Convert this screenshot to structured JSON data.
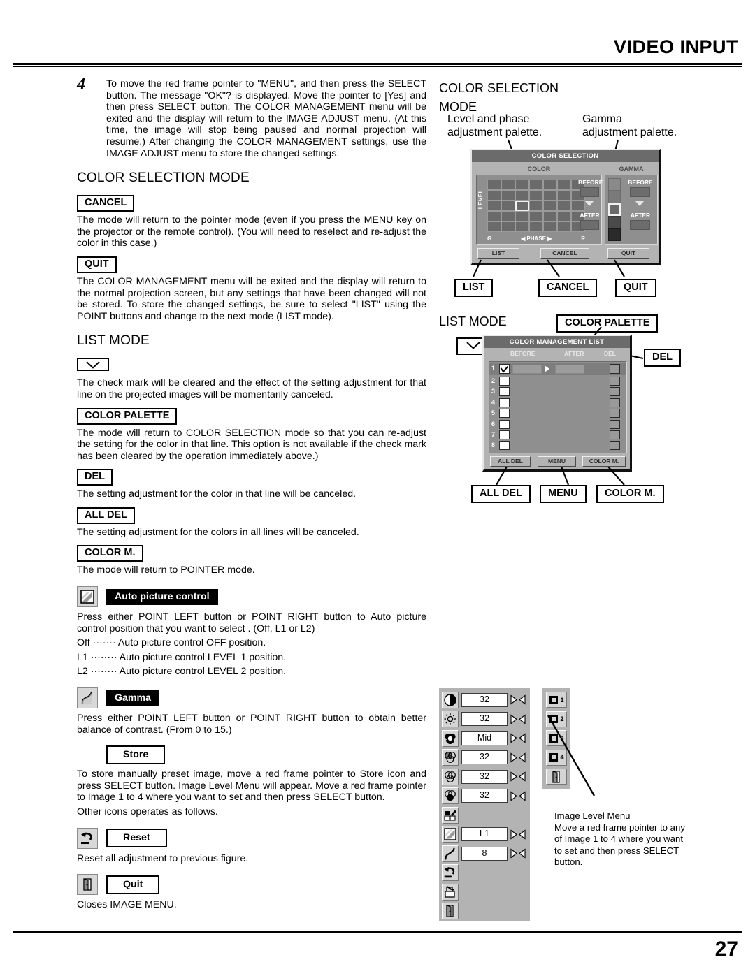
{
  "header": {
    "title": "VIDEO INPUT",
    "page_number": "27"
  },
  "left": {
    "step": {
      "number": "4",
      "text": "To move the red frame pointer to \"MENU\", and then press the SELECT button. The message \"OK\"? is displayed. Move the pointer to [Yes] and then press SELECT button. The COLOR MANAGEMENT menu will be exited and the display will return to the IMAGE ADJUST menu. (At this time, the image will stop being paused and normal projection will resume.) After changing the COLOR MANAGEMENT settings, use the IMAGE ADJUST menu to store the changed settings."
    },
    "color_selection_mode": {
      "heading": "COLOR SELECTION MODE",
      "cancel_key": "CANCEL",
      "cancel_text": "The mode will return to the pointer mode (even if you press the MENU key on the projector or the remote control). (You will need to reselect and re-adjust the color in this case.)",
      "quit_key": "QUIT",
      "quit_text": "The COLOR MANAGEMENT menu will be exited and the display will return to the normal projection screen, but any settings that have been changed will not be stored. To store the changed settings, be sure to select \"LIST\" using the POINT buttons and change to the next mode (LIST mode)."
    },
    "list_mode": {
      "heading": "LIST MODE",
      "check_text": "The check mark will be cleared and the effect of the setting adjustment for that line on the projected images will be momentarily canceled.",
      "color_palette_key": "COLOR PALETTE",
      "color_palette_text": "The mode will return to COLOR SELECTION mode so that you can re-adjust the setting for the color in that line. This option is not available if the check mark has been cleared by the operation immediately above.)",
      "del_key": "DEL",
      "del_text": "The setting adjustment for the color in that line will be canceled.",
      "all_del_key": "ALL DEL",
      "all_del_text": "The setting adjustment for the colors in all lines will be canceled.",
      "color_m_key": "COLOR M.",
      "color_m_text": "The mode will return to POINTER mode."
    },
    "auto_picture_control": {
      "label": "Auto picture control",
      "text": "Press either POINT LEFT button or POINT RIGHT button to Auto picture control position that you want to select . (Off, L1 or L2)",
      "line_off": "Off ······· Auto picture control OFF position.",
      "line_l1": "L1 ········ Auto picture control LEVEL 1 position.",
      "line_l2": "L2 ········ Auto picture control LEVEL 2 position."
    },
    "gamma": {
      "label": "Gamma",
      "text": "Press either POINT LEFT button or POINT RIGHT button to obtain better balance of contrast.  (From 0 to 15.)"
    },
    "store": {
      "label": "Store",
      "text": "To store manually preset image, move a red frame pointer to Store icon and press SELECT button.  Image Level Menu will appear. Move a red frame pointer to Image 1 to 4 where you want to set and then press SELECT button.",
      "other": "Other icons operates as follows."
    },
    "reset": {
      "label": "Reset",
      "text": "Reset all adjustment to previous figure."
    },
    "quit": {
      "label": "Quit",
      "text": "Closes IMAGE MENU."
    }
  },
  "right": {
    "cs_mode_title_l1": "COLOR SELECTION",
    "cs_mode_title_l2": "MODE",
    "callout_level": "Level and phase\nadjustment palette.",
    "callout_level_l1": "Level and phase",
    "callout_level_l2": "adjustment palette.",
    "callout_gamma_l1": "Gamma",
    "callout_gamma_l2": "adjustment palette.",
    "color_selection_panel": {
      "title": "COLOR SELECTION",
      "color_header": "COLOR",
      "gamma_header": "GAMMA",
      "level_axis": "LEVEL",
      "phase_axis_left": "G",
      "phase_axis_label": "◀ PHASE ▶",
      "phase_axis_right": "R",
      "before": "BEFORE",
      "after": "AFTER",
      "gamma_before": "BEFORE",
      "gamma_after": "AFTER",
      "buttons": [
        "LIST",
        "CANCEL",
        "QUIT"
      ]
    },
    "cs_labels": [
      "LIST",
      "CANCEL",
      "QUIT"
    ],
    "list_mode_title": "LIST MODE",
    "color_palette_label": "COLOR PALETTE",
    "del_label": "DEL",
    "cml_panel": {
      "title": "COLOR MANAGEMENT LIST",
      "columns": [
        "BEFORE",
        "AFTER",
        "DEL"
      ],
      "rows": [
        "1",
        "2",
        "3",
        "4",
        "5",
        "6",
        "7",
        "8"
      ],
      "checked_row": "1",
      "buttons": [
        "ALL DEL",
        "MENU",
        "COLOR M."
      ]
    },
    "cml_labels": [
      "ALL DEL",
      "MENU",
      "COLOR M."
    ]
  },
  "image_level_menu": {
    "rows": [
      {
        "icon": "contrast-icon",
        "value": "32",
        "has_arrows": true
      },
      {
        "icon": "brightness-icon",
        "value": "32",
        "has_arrows": true
      },
      {
        "icon": "color-temp-icon",
        "value": "Mid",
        "has_arrows": true
      },
      {
        "icon": "red-level-icon",
        "value": "32",
        "has_arrows": true
      },
      {
        "icon": "green-level-icon",
        "value": "32",
        "has_arrows": true
      },
      {
        "icon": "blue-level-icon",
        "value": "32",
        "has_arrows": true
      },
      {
        "icon": "color-management-icon",
        "value": "",
        "has_arrows": false
      },
      {
        "icon": "auto-picture-control-icon",
        "value": "L1",
        "has_arrows": true
      },
      {
        "icon": "gamma-icon",
        "value": "8",
        "has_arrows": true
      },
      {
        "icon": "reset-icon",
        "value": "",
        "has_arrows": false
      },
      {
        "icon": "store-icon",
        "value": "",
        "has_arrows": false
      },
      {
        "icon": "quit-icon",
        "value": "",
        "has_arrows": false
      }
    ],
    "side_items": [
      "1",
      "2",
      "3",
      "4"
    ],
    "side_quit_icon": "quit-icon",
    "caption_title": "Image Level Menu",
    "caption_l1": "Move a red frame pointer to any",
    "caption_l2": "of Image 1 to 4 where you want",
    "caption_l3": "to set  and then press SELECT",
    "caption_l4": "button."
  },
  "colors": {
    "osd_bg": "#b3b3b3",
    "osd_title_bar": "#6b6b6b",
    "osd_inset": "#8f8f8f",
    "swatch": "#6d6d6d"
  }
}
